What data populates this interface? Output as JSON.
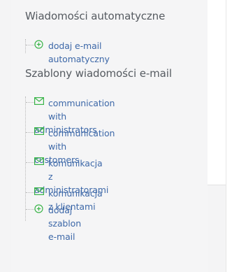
{
  "automatic": {
    "heading": "Wiadomości automatyczne",
    "add_link": "dodaj e-mail automatyczny"
  },
  "templates": {
    "heading": "Szablony wiadomości e-mail",
    "items": [
      {
        "label_line1": "communication with",
        "label_line2": "administrators",
        "icon": "mail-icon"
      },
      {
        "label_line1": "communication with",
        "label_line2": "customers",
        "icon": "mail-icon"
      },
      {
        "label_line1": "komunikacja z",
        "label_line2": "administratorami",
        "icon": "mail-icon"
      },
      {
        "label_line1": "komunikacja z klientami",
        "label_line2": "",
        "icon": "mail-icon"
      }
    ],
    "add_link": "dodaj szablon e-mail"
  },
  "colors": {
    "link": "#3d68a8",
    "icon_green": "#3bb54a",
    "heading": "#555a60"
  }
}
